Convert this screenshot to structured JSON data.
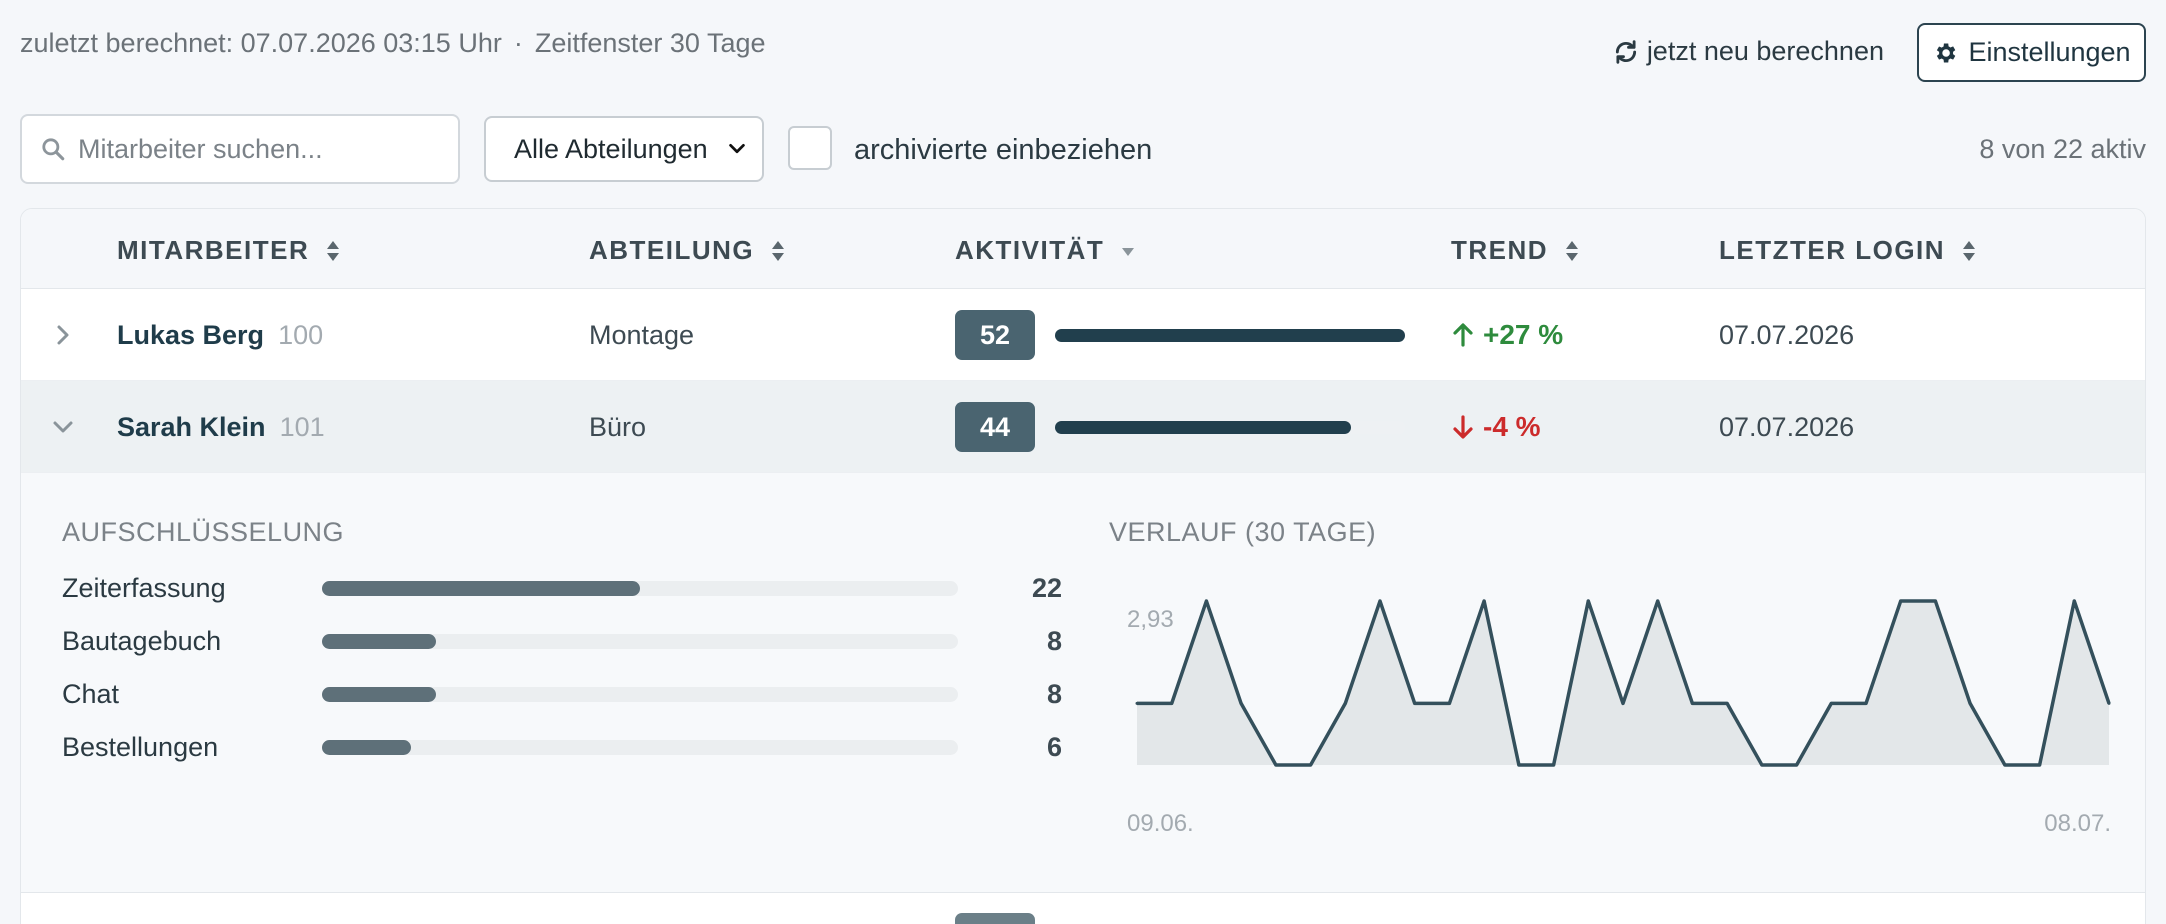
{
  "header": {
    "last_calculated": "zuletzt berechnet: 07.07.2026 03:15 Uhr",
    "separator": "·",
    "window": "Zeitfenster 30 Tage",
    "recalc_label": "jetzt neu berechnen",
    "settings_label": "Einstellungen"
  },
  "filters": {
    "search_placeholder": "Mitarbeiter suchen...",
    "department_selected": "Alle Abteilungen",
    "archive_label": "archivierte einbeziehen",
    "archive_checked": false,
    "active_count": "8 von 22 aktiv"
  },
  "table": {
    "columns": {
      "employee": "MITARBEITER",
      "department": "ABTEILUNG",
      "activity": "AKTIVITÄT",
      "trend": "TREND",
      "last_login": "LETZTER LOGIN"
    },
    "rows": [
      {
        "name": "Lukas Berg",
        "id": "100",
        "department": "Montage",
        "score": "52",
        "score_fraction": 1.0,
        "trend": "+27 %",
        "trend_dir": "up",
        "last_login": "07.07.2026",
        "expanded": false
      },
      {
        "name": "Sarah Klein",
        "id": "101",
        "department": "Büro",
        "score": "44",
        "score_fraction": 0.846,
        "trend": "-4 %",
        "trend_dir": "down",
        "last_login": "07.07.2026",
        "expanded": true
      }
    ]
  },
  "detail": {
    "breakdown_title": "AUFSCHLÜSSELUNG",
    "breakdown": [
      {
        "label": "Zeiterfassung",
        "value": "22",
        "fraction": 0.5
      },
      {
        "label": "Bautagebuch",
        "value": "8",
        "fraction": 0.18
      },
      {
        "label": "Chat",
        "value": "8",
        "fraction": 0.18
      },
      {
        "label": "Bestellungen",
        "value": "6",
        "fraction": 0.14
      }
    ],
    "history_title": "VERLAUF (30 TAGE)",
    "history_max_label": "2,93",
    "history_start": "09.06.",
    "history_end": "08.07."
  },
  "chart_data": {
    "type": "area",
    "title": "VERLAUF (30 TAGE)",
    "x": [
      "09.06.",
      "",
      "",
      "",
      "",
      "",
      "",
      "",
      "",
      "",
      "",
      "",
      "",
      "",
      "",
      "",
      "",
      "",
      "",
      "",
      "",
      "",
      "",
      "",
      "",
      "",
      "",
      "",
      "",
      "08.07."
    ],
    "values": [
      1.1,
      1.1,
      2.93,
      1.1,
      0,
      0,
      1.1,
      2.93,
      1.1,
      1.1,
      2.93,
      0,
      0,
      2.93,
      1.1,
      2.93,
      1.1,
      1.1,
      0,
      0,
      1.1,
      1.1,
      2.93,
      2.93,
      1.1,
      0,
      0,
      2.93,
      1.1
    ],
    "ylim": [
      0,
      2.93
    ]
  },
  "colors": {
    "accent": "#213f4d",
    "badge": "#4a6470",
    "trend_up": "#2e8b3d",
    "trend_down": "#cc2b2b",
    "chart_line": "#34505c",
    "chart_fill": "#e3e7e9"
  },
  "icons": {
    "search": "search-icon",
    "refresh": "refresh-icon",
    "settings": "gear-icon"
  }
}
